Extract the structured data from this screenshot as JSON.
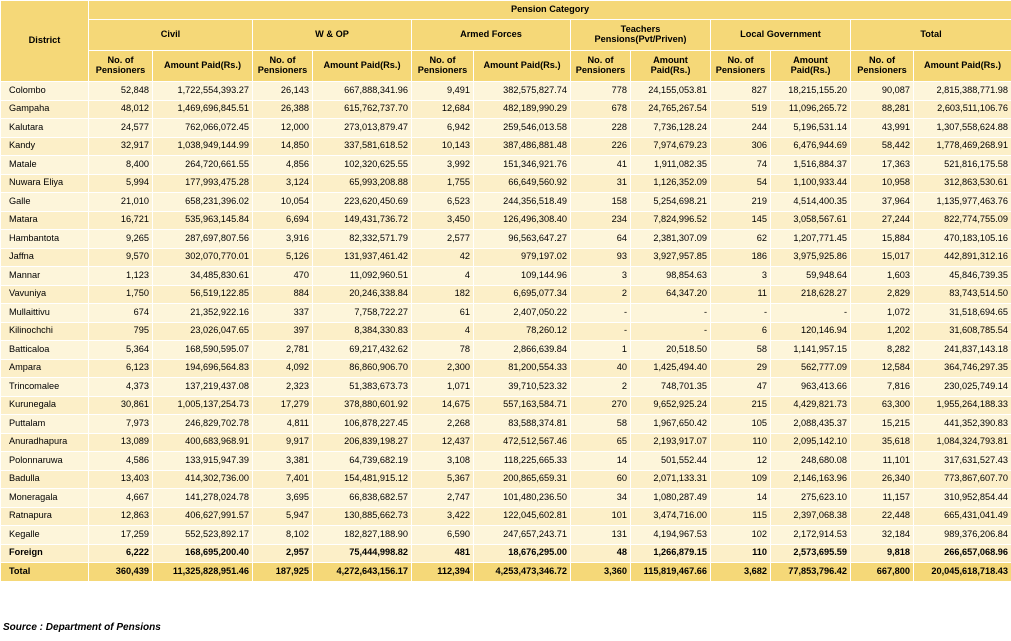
{
  "header": {
    "district": "District",
    "pension_category": "Pension Category",
    "categories": [
      "Civil",
      "W & OP",
      "Armed Forces",
      "Teachers Pensions(Pvt/Priven)",
      "Local Government",
      "Total"
    ],
    "sub_headers": [
      [
        "No. of Pensioners",
        "Amount Paid(Rs.)"
      ],
      [
        "No. of Pensioners",
        "Amount Paid(Rs.)"
      ],
      [
        "No. of Pensioners",
        "Amount Paid(Rs.)"
      ],
      [
        "No. of Pensioners",
        "Amount Paid(Rs.)"
      ],
      [
        "No. of Pensioners",
        "Amount Paid(Rs.)"
      ],
      [
        "No. of Pensioners",
        "Amount Paid(Rs.)"
      ]
    ]
  },
  "rows": [
    [
      "Colombo",
      "52,848",
      "1,722,554,393.27",
      "26,143",
      "667,888,341.96",
      "9,491",
      "382,575,827.74",
      "778",
      "24,155,053.81",
      "827",
      "18,215,155.20",
      "90,087",
      "2,815,388,771.98"
    ],
    [
      "Gampaha",
      "48,012",
      "1,469,696,845.51",
      "26,388",
      "615,762,737.70",
      "12,684",
      "482,189,990.29",
      "678",
      "24,765,267.54",
      "519",
      "11,096,265.72",
      "88,281",
      "2,603,511,106.76"
    ],
    [
      "Kalutara",
      "24,577",
      "762,066,072.45",
      "12,000",
      "273,013,879.47",
      "6,942",
      "259,546,013.58",
      "228",
      "7,736,128.24",
      "244",
      "5,196,531.14",
      "43,991",
      "1,307,558,624.88"
    ],
    [
      "Kandy",
      "32,917",
      "1,038,949,144.99",
      "14,850",
      "337,581,618.52",
      "10,143",
      "387,486,881.48",
      "226",
      "7,974,679.23",
      "306",
      "6,476,944.69",
      "58,442",
      "1,778,469,268.91"
    ],
    [
      "Matale",
      "8,400",
      "264,720,661.55",
      "4,856",
      "102,320,625.55",
      "3,992",
      "151,346,921.76",
      "41",
      "1,911,082.35",
      "74",
      "1,516,884.37",
      "17,363",
      "521,816,175.58"
    ],
    [
      "Nuwara Eliya",
      "5,994",
      "177,993,475.28",
      "3,124",
      "65,993,208.88",
      "1,755",
      "66,649,560.92",
      "31",
      "1,126,352.09",
      "54",
      "1,100,933.44",
      "10,958",
      "312,863,530.61"
    ],
    [
      "Galle",
      "21,010",
      "658,231,396.02",
      "10,054",
      "223,620,450.69",
      "6,523",
      "244,356,518.49",
      "158",
      "5,254,698.21",
      "219",
      "4,514,400.35",
      "37,964",
      "1,135,977,463.76"
    ],
    [
      "Matara",
      "16,721",
      "535,963,145.84",
      "6,694",
      "149,431,736.72",
      "3,450",
      "126,496,308.40",
      "234",
      "7,824,996.52",
      "145",
      "3,058,567.61",
      "27,244",
      "822,774,755.09"
    ],
    [
      "Hambantota",
      "9,265",
      "287,697,807.56",
      "3,916",
      "82,332,571.79",
      "2,577",
      "96,563,647.27",
      "64",
      "2,381,307.09",
      "62",
      "1,207,771.45",
      "15,884",
      "470,183,105.16"
    ],
    [
      "Jaffna",
      "9,570",
      "302,070,770.01",
      "5,126",
      "131,937,461.42",
      "42",
      "979,197.02",
      "93",
      "3,927,957.85",
      "186",
      "3,975,925.86",
      "15,017",
      "442,891,312.16"
    ],
    [
      "Mannar",
      "1,123",
      "34,485,830.61",
      "470",
      "11,092,960.51",
      "4",
      "109,144.96",
      "3",
      "98,854.63",
      "3",
      "59,948.64",
      "1,603",
      "45,846,739.35"
    ],
    [
      "Vavuniya",
      "1,750",
      "56,519,122.85",
      "884",
      "20,246,338.84",
      "182",
      "6,695,077.34",
      "2",
      "64,347.20",
      "11",
      "218,628.27",
      "2,829",
      "83,743,514.50"
    ],
    [
      "Mullaittivu",
      "674",
      "21,352,922.16",
      "337",
      "7,758,722.27",
      "61",
      "2,407,050.22",
      "-",
      "-",
      "-",
      "-",
      "1,072",
      "31,518,694.65"
    ],
    [
      "Kilinochchi",
      "795",
      "23,026,047.65",
      "397",
      "8,384,330.83",
      "4",
      "78,260.12",
      "-",
      "-",
      "6",
      "120,146.94",
      "1,202",
      "31,608,785.54"
    ],
    [
      "Batticaloa",
      "5,364",
      "168,590,595.07",
      "2,781",
      "69,217,432.62",
      "78",
      "2,866,639.84",
      "1",
      "20,518.50",
      "58",
      "1,141,957.15",
      "8,282",
      "241,837,143.18"
    ],
    [
      "Ampara",
      "6,123",
      "194,696,564.83",
      "4,092",
      "86,860,906.70",
      "2,300",
      "81,200,554.33",
      "40",
      "1,425,494.40",
      "29",
      "562,777.09",
      "12,584",
      "364,746,297.35"
    ],
    [
      "Trincomalee",
      "4,373",
      "137,219,437.08",
      "2,323",
      "51,383,673.73",
      "1,071",
      "39,710,523.32",
      "2",
      "748,701.35",
      "47",
      "963,413.66",
      "7,816",
      "230,025,749.14"
    ],
    [
      "Kurunegala",
      "30,861",
      "1,005,137,254.73",
      "17,279",
      "378,880,601.92",
      "14,675",
      "557,163,584.71",
      "270",
      "9,652,925.24",
      "215",
      "4,429,821.73",
      "63,300",
      "1,955,264,188.33"
    ],
    [
      "Puttalam",
      "7,973",
      "246,829,702.78",
      "4,811",
      "106,878,227.45",
      "2,268",
      "83,588,374.81",
      "58",
      "1,967,650.42",
      "105",
      "2,088,435.37",
      "15,215",
      "441,352,390.83"
    ],
    [
      "Anuradhapura",
      "13,089",
      "400,683,968.91",
      "9,917",
      "206,839,198.27",
      "12,437",
      "472,512,567.46",
      "65",
      "2,193,917.07",
      "110",
      "2,095,142.10",
      "35,618",
      "1,084,324,793.81"
    ],
    [
      "Polonnaruwa",
      "4,586",
      "133,915,947.39",
      "3,381",
      "64,739,682.19",
      "3,108",
      "118,225,665.33",
      "14",
      "501,552.44",
      "12",
      "248,680.08",
      "11,101",
      "317,631,527.43"
    ],
    [
      "Badulla",
      "13,403",
      "414,302,736.00",
      "7,401",
      "154,481,915.12",
      "5,367",
      "200,865,659.31",
      "60",
      "2,071,133.31",
      "109",
      "2,146,163.96",
      "26,340",
      "773,867,607.70"
    ],
    [
      "Moneragala",
      "4,667",
      "141,278,024.78",
      "3,695",
      "66,838,682.57",
      "2,747",
      "101,480,236.50",
      "34",
      "1,080,287.49",
      "14",
      "275,623.10",
      "11,157",
      "310,952,854.44"
    ],
    [
      "Ratnapura",
      "12,863",
      "406,627,991.57",
      "5,947",
      "130,885,662.73",
      "3,422",
      "122,045,602.81",
      "101",
      "3,474,716.00",
      "115",
      "2,397,068.38",
      "22,448",
      "665,431,041.49"
    ],
    [
      "Kegalle",
      "17,259",
      "552,523,892.17",
      "8,102",
      "182,827,188.90",
      "6,590",
      "247,657,243.71",
      "131",
      "4,194,967.53",
      "102",
      "2,172,914.53",
      "32,184",
      "989,376,206.84"
    ]
  ],
  "foreign": [
    "Foreign",
    "6,222",
    "168,695,200.40",
    "2,957",
    "75,444,998.82",
    "481",
    "18,676,295.00",
    "48",
    "1,266,879.15",
    "110",
    "2,573,695.59",
    "9,818",
    "266,657,068.96"
  ],
  "total": [
    "Total",
    "360,439",
    "11,325,828,951.46",
    "187,925",
    "4,272,643,156.17",
    "112,394",
    "4,253,473,346.72",
    "3,360",
    "115,819,467.66",
    "3,682",
    "77,853,796.42",
    "667,800",
    "20,045,618,718.43"
  ],
  "source": "Source : Department of Pensions",
  "colors": {
    "header": "#f5d878",
    "row_odd": "#fdf5da",
    "row_even": "#fcefc8"
  }
}
